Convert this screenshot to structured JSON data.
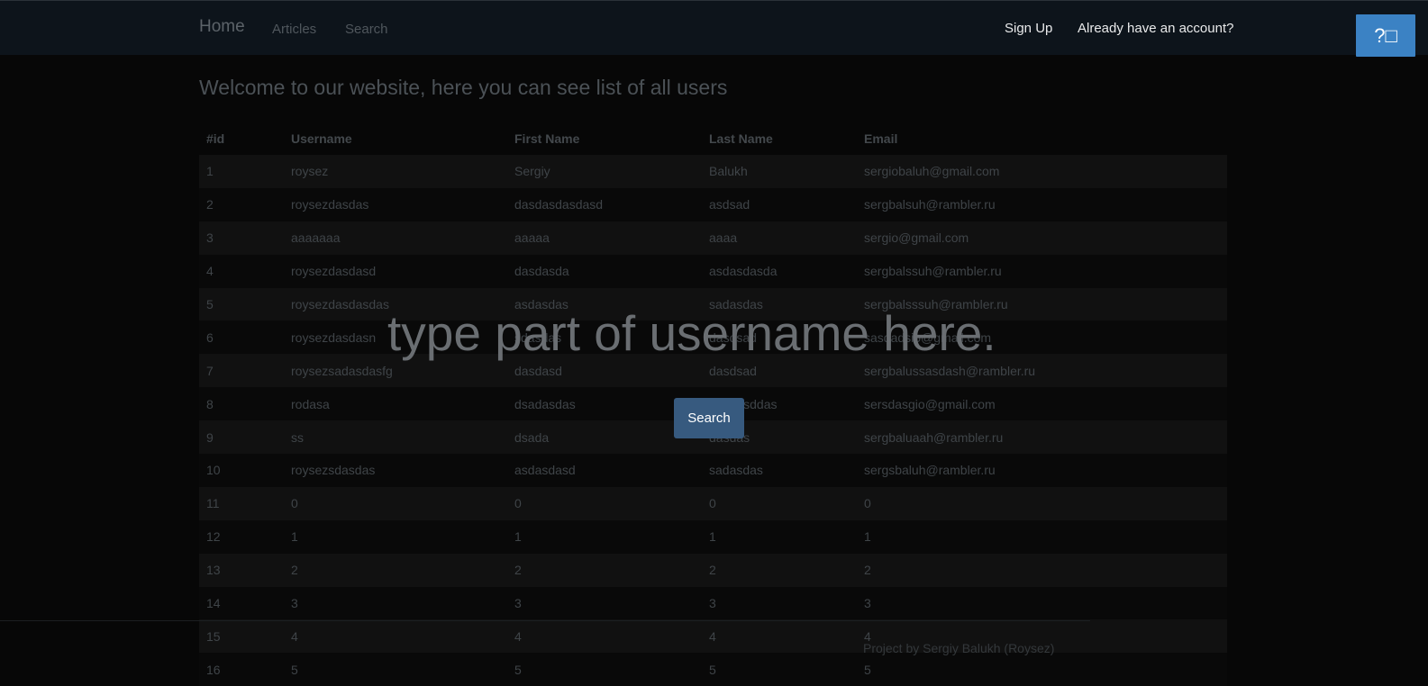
{
  "nav": {
    "brand": "Home",
    "links": [
      "Articles",
      "Search"
    ],
    "signup": "Sign Up",
    "login": "Already have an account?",
    "help_label": "?□"
  },
  "page": {
    "welcome": "Welcome to our website, here you can see list of all users"
  },
  "table": {
    "headers": [
      "#id",
      "Username",
      "First Name",
      "Last Name",
      "Email"
    ],
    "rows": [
      [
        "1",
        "roysez",
        "Sergiy",
        "Balukh",
        "sergiobaluh@gmail.com"
      ],
      [
        "2",
        "roysezdasdas",
        "dasdasdasdasd",
        "asdsad",
        "sergbalsuh@rambler.ru"
      ],
      [
        "3",
        "aaaaaaa",
        "aaaaa",
        "aaaa",
        "sergio@gmail.com"
      ],
      [
        "4",
        "roysezdasdasd",
        "dasdasda",
        "asdasdasda",
        "sergbalssuh@rambler.ru"
      ],
      [
        "5",
        "roysezdasdasdas",
        "asdasdas",
        "sadasdas",
        "sergbalsssuh@rambler.ru"
      ],
      [
        "6",
        "roysezdasdasn",
        "sdasdas",
        "dasdsad",
        "sasdadsio@gmail.com"
      ],
      [
        "7",
        "roysezsadasdasfg",
        "dasdasd",
        "dasdsad",
        "sergbalussasdash@rambler.ru"
      ],
      [
        "8",
        "rodasa",
        "dsadasdas",
        "dasdasddas",
        "sersdasgio@gmail.com"
      ],
      [
        "9",
        "ss",
        "dsada",
        "dasdas",
        "sergbaluaah@rambler.ru"
      ],
      [
        "10",
        "roysezsdasdas",
        "asdasdasd",
        "sadasdas",
        "sergsbaluh@rambler.ru"
      ],
      [
        "11",
        "0",
        "0",
        "0",
        "0"
      ],
      [
        "12",
        "1",
        "1",
        "1",
        "1"
      ],
      [
        "13",
        "2",
        "2",
        "2",
        "2"
      ],
      [
        "14",
        "3",
        "3",
        "3",
        "3"
      ],
      [
        "15",
        "4",
        "4",
        "4",
        "4"
      ],
      [
        "16",
        "5",
        "5",
        "5",
        "5"
      ]
    ]
  },
  "search_overlay": {
    "prompt": "type part of username here.",
    "button": "Search"
  },
  "footer": {
    "text": "Project by Sergiy Balukh (Roysez)"
  }
}
